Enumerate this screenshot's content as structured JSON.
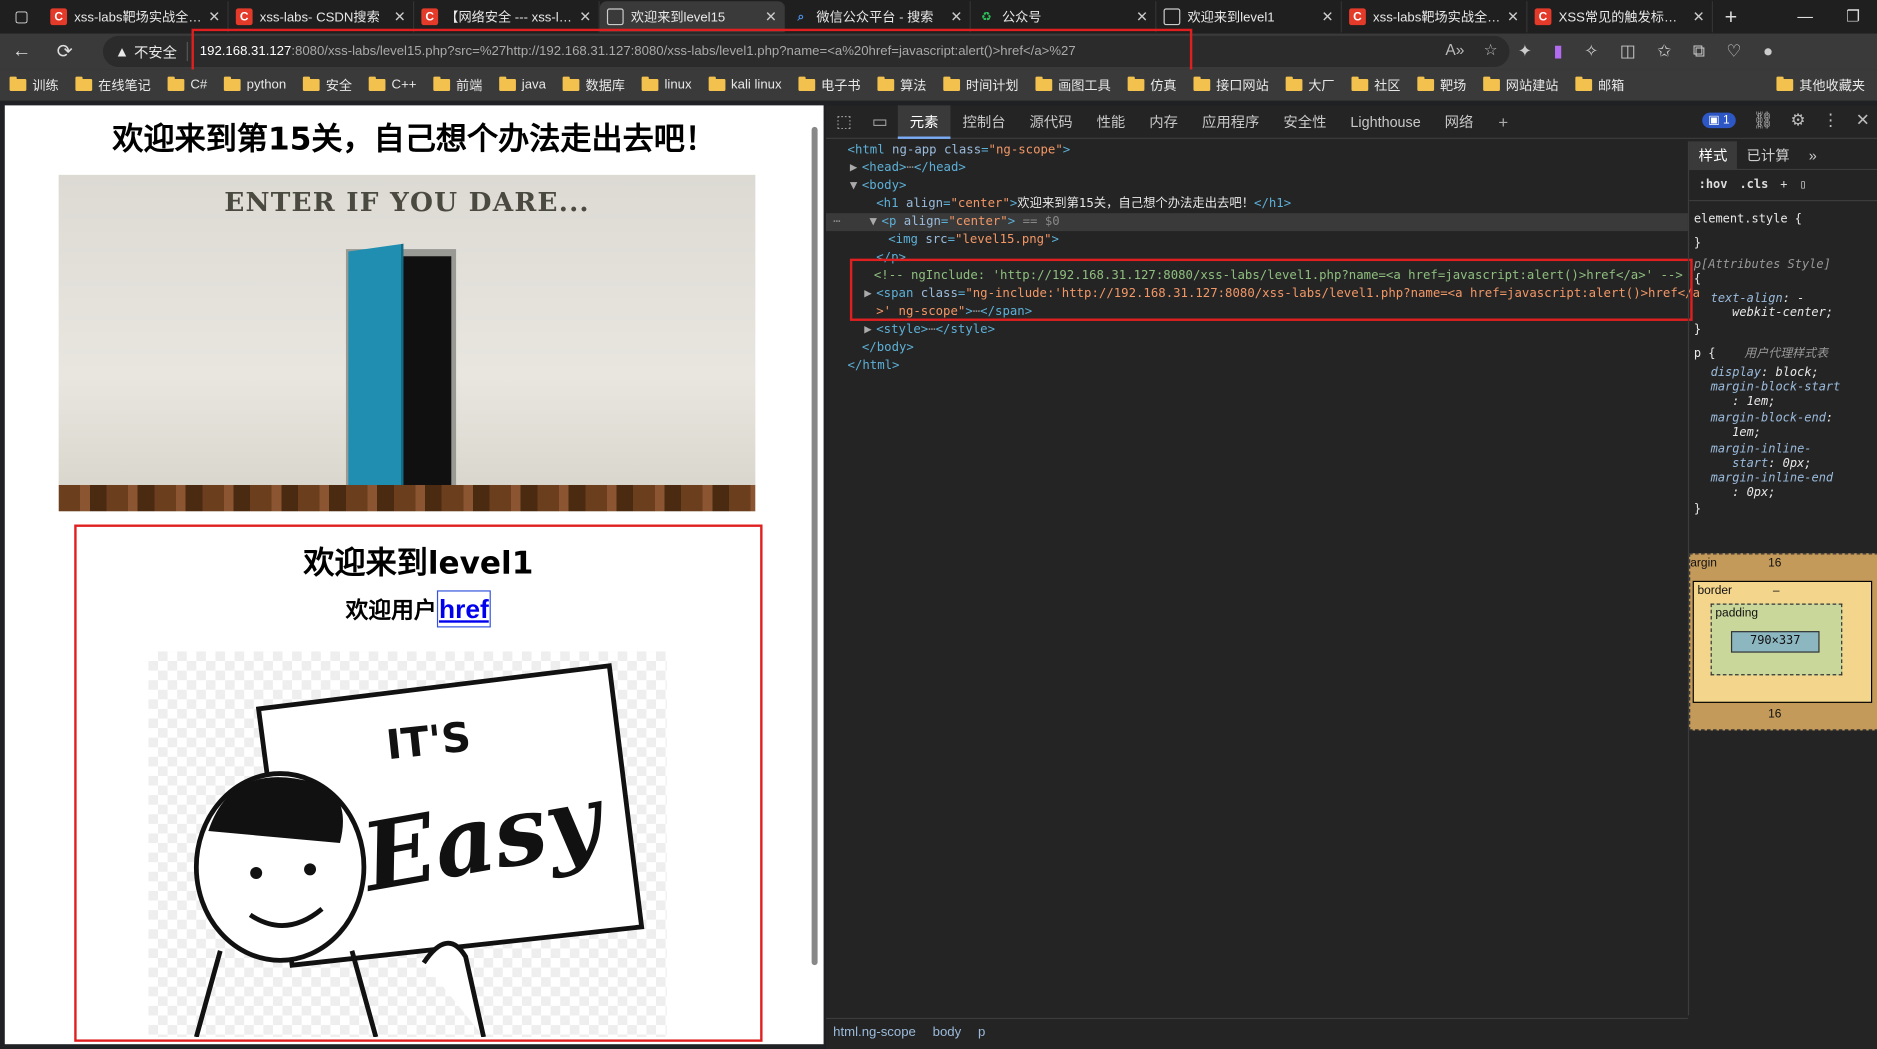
{
  "browser": {
    "tabs": [
      {
        "title": "xss-labs靶场实战全通关",
        "icon": "csdn",
        "active": false
      },
      {
        "title": "xss-labs- CSDN搜索",
        "icon": "csdn",
        "active": false
      },
      {
        "title": "【网络安全 --- xss-labs",
        "icon": "csdn",
        "active": false
      },
      {
        "title": "欢迎来到level15",
        "icon": "doc",
        "active": true
      },
      {
        "title": "微信公众平台 - 搜索",
        "icon": "search",
        "active": false
      },
      {
        "title": "公众号",
        "icon": "wechat",
        "active": false
      },
      {
        "title": "欢迎来到level1",
        "icon": "doc",
        "active": false
      },
      {
        "title": "xss-labs靶场实战全通关",
        "icon": "csdn",
        "active": false
      },
      {
        "title": "XSS常见的触发标签_xss",
        "icon": "csdn",
        "active": false
      }
    ],
    "security_label": "不安全",
    "url_host": "192.168.31.127",
    "url_rest": ":8080/xss-labs/level15.php?src=%27http://192.168.31.127:8080/xss-labs/level1.php?name=<a%20href=javascript:alert()>href</a>%27",
    "bookmarks": [
      "训练",
      "在线笔记",
      "C#",
      "python",
      "安全",
      "C++",
      "前端",
      "java",
      "数据库",
      "linux",
      "kali linux",
      "电子书",
      "算法",
      "时间计划",
      "画图工具",
      "仿真",
      "接口网站",
      "大厂",
      "社区",
      "靶场",
      "网站建站",
      "邮箱"
    ],
    "other_bookmarks": "其他收藏夹"
  },
  "page": {
    "heading": "欢迎来到第15关，自己想个办法走出去吧！",
    "door_text": "ENTER IF YOU DARE...",
    "iframe_heading": "欢迎来到level1",
    "welcome_prefix": "欢迎用户",
    "welcome_link": "href"
  },
  "devtools": {
    "tabs": [
      "元素",
      "控制台",
      "源代码",
      "性能",
      "内存",
      "应用程序",
      "安全性",
      "Lighthouse",
      "网络"
    ],
    "active_tab": "元素",
    "issues_count": "1",
    "styles_tabs": [
      "样式",
      "已计算"
    ],
    "filter_hov": ":hov",
    "filter_cls": ".cls",
    "breadcrumbs": [
      "html.ng-scope",
      "body",
      "p"
    ],
    "box_model": {
      "margin_label": "argin",
      "margin_top": "16",
      "margin_bottom": "16",
      "border_label": "border",
      "padding_label": "padding",
      "content_size": "790×337",
      "dash": "–"
    }
  }
}
